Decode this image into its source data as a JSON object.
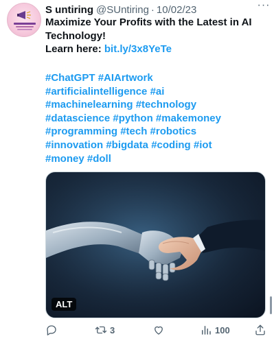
{
  "tweet": {
    "display_name": "S untiring",
    "handle": "@SUntiring",
    "separator": "·",
    "date": "10/02/23",
    "more_label": "···",
    "text_line1": "Maximize Your Profits with the Latest in AI",
    "text_line2": "Technology!",
    "learn_here": "Learn here: ",
    "link": "bit.ly/3x8YeTe",
    "hashtags": [
      [
        "#ChatGPT",
        "#AIArtwork"
      ],
      [
        "#artificialintelligence",
        "#ai"
      ],
      [
        "#machinelearning",
        "#technology"
      ],
      [
        "#datascience",
        "#python",
        "#makemoney"
      ],
      [
        "#programming",
        "#tech",
        "#robotics"
      ],
      [
        "#innovation",
        "#bigdata",
        "#coding",
        "#iot"
      ],
      [
        "#money",
        "#doll"
      ]
    ],
    "media_alt_badge": "ALT",
    "actions": {
      "reply_count": "",
      "retweet_count": "3",
      "like_count": "",
      "views_count": "100"
    }
  },
  "icons": {
    "reply": "reply-icon",
    "retweet": "retweet-icon",
    "like": "heart-icon",
    "views": "views-icon",
    "share": "share-icon",
    "more": "more-icon"
  },
  "colors": {
    "link": "#1d9bf0",
    "text": "#0f1419",
    "secondary": "#536471"
  }
}
